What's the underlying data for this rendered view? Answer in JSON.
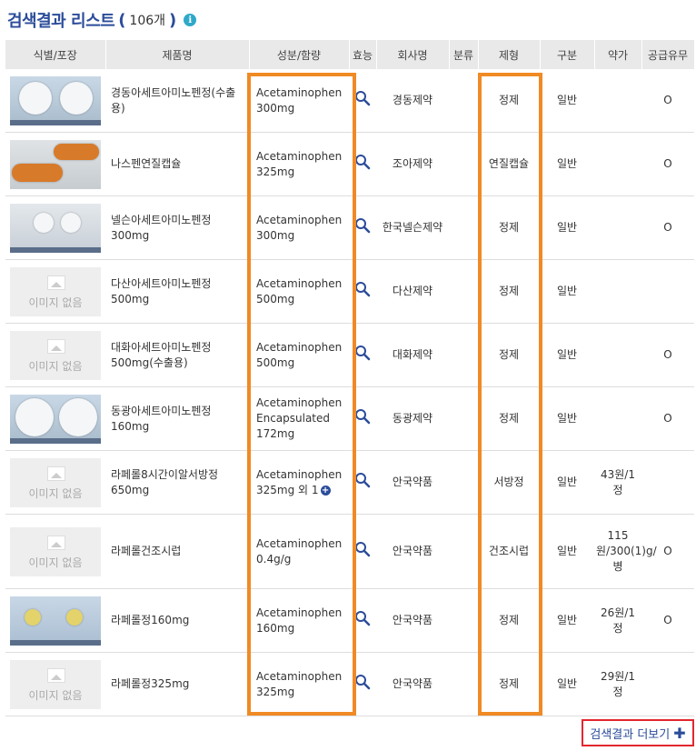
{
  "header": {
    "title": "검색결과 리스트",
    "open_paren": "(",
    "count": "106개",
    "close_paren": ")",
    "info_icon": "i"
  },
  "columns": [
    "식별/포장",
    "제품명",
    "성분/함량",
    "효능",
    "회사명",
    "분류",
    "제형",
    "구분",
    "약가",
    "공급유무"
  ],
  "no_image_label": "이미지 없음",
  "rows": [
    {
      "image": "photo-white",
      "name": "경동아세트아미노펜정(수출용)",
      "ingredient": "Acetaminophen 300mg",
      "company": "경동제약",
      "category": "",
      "form": "정제",
      "type": "일반",
      "price": "",
      "supply": "O"
    },
    {
      "image": "photo-orange",
      "name": "나스펜연질캡슐",
      "ingredient": "Acetaminophen 325mg",
      "company": "조아제약",
      "category": "",
      "form": "연질캡슐",
      "type": "일반",
      "price": "",
      "supply": "O"
    },
    {
      "image": "photo-gray",
      "name": "넬슨아세트아미노펜정 300mg",
      "ingredient": "Acetaminophen 300mg",
      "company": "한국넬슨제약",
      "category": "",
      "form": "정제",
      "type": "일반",
      "price": "",
      "supply": "O"
    },
    {
      "image": "none",
      "name": "다산아세트아미노펜정 500mg",
      "ingredient": "Acetaminophen 500mg",
      "company": "다산제약",
      "category": "",
      "form": "정제",
      "type": "일반",
      "price": "",
      "supply": ""
    },
    {
      "image": "none",
      "name": "대화아세트아미노펜정 500mg(수출용)",
      "ingredient": "Acetaminophen 500mg",
      "company": "대화제약",
      "category": "",
      "form": "정제",
      "type": "일반",
      "price": "",
      "supply": "O"
    },
    {
      "image": "photo-white2",
      "name": "동광아세트아미노펜정 160mg",
      "ingredient": "Acetaminophen Encapsulated 172mg",
      "company": "동광제약",
      "category": "",
      "form": "정제",
      "type": "일반",
      "price": "",
      "supply": "O"
    },
    {
      "image": "none",
      "name": "라페롤8시간이알서방정 650mg",
      "ingredient": "Acetaminophen 325mg 외 1",
      "company": "안국약품",
      "category": "",
      "form": "서방정",
      "type": "일반",
      "price": "43원/1정",
      "supply": ""
    },
    {
      "image": "none",
      "name": "라페롤건조시럽",
      "ingredient": "Acetaminophen 0.4g/g",
      "company": "안국약품",
      "category": "",
      "form": "건조시럽",
      "type": "일반",
      "price": "115원/300(1)g/병",
      "supply": "O"
    },
    {
      "image": "photo-yellow",
      "name": "라페롤정160mg",
      "ingredient": "Acetaminophen 160mg",
      "company": "안국약품",
      "category": "",
      "form": "정제",
      "type": "일반",
      "price": "26원/1정",
      "supply": "O"
    },
    {
      "image": "none",
      "name": "라페롤정325mg",
      "ingredient": "Acetaminophen 325mg",
      "company": "안국약품",
      "category": "",
      "form": "정제",
      "type": "일반",
      "price": "29원/1정",
      "supply": ""
    }
  ],
  "more_button": {
    "label": "검색결과 더보기",
    "icon": "✚"
  },
  "colors": {
    "title": "#2b4c9a",
    "highlight": "#f08a24",
    "more_border": "#e3262e",
    "header_bg": "#e9e9e9"
  }
}
